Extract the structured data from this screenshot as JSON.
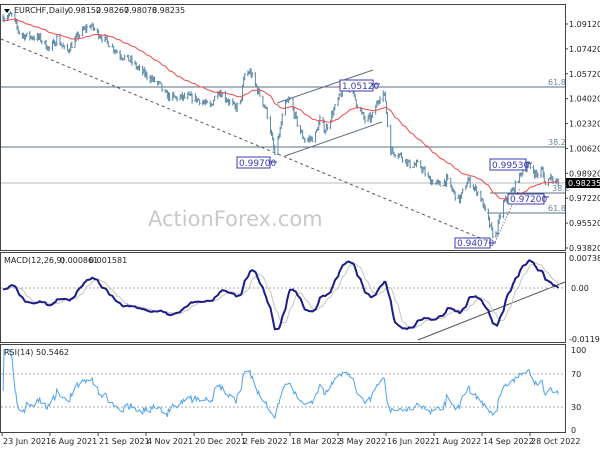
{
  "header": {
    "symbol": "EURCHF,Daily",
    "ohlc": [
      "0.98152",
      "0.98267",
      "0.98078",
      "0.98235"
    ]
  },
  "watermark": "ActionForex.com",
  "colors": {
    "bars": "#5f8aa6",
    "moving_average": "#f04848",
    "macd": "#1c1c8a",
    "signal": "#c4c4c4",
    "rsi": "#4ea2f0",
    "label_box": "#3b3bb0",
    "current_price_bg": "#000000"
  },
  "macd_panel": {
    "title": "MACD(12,26,9)",
    "value1": "0.000861",
    "value2": "0.001581",
    "axis_labels": [
      "0.007384",
      "0.00",
      "-0.0119"
    ]
  },
  "rsi_panel": {
    "title": "RSI(14)",
    "value": "50.5462",
    "axis_labels": [
      "100",
      "70",
      "30",
      "0"
    ]
  },
  "price_axis": {
    "ticks": [
      "1.09120",
      "1.07420",
      "1.05720",
      "1.04020",
      "1.02320",
      "1.00620",
      "0.98920",
      "0.97220",
      "0.95520",
      "0.93820"
    ],
    "current_price": "0.98235"
  },
  "annotations": {
    "price_labels": [
      "0.99700",
      "1.05120",
      "0.99530",
      "0.97200",
      "0.94070"
    ],
    "fib_levels": [
      {
        "label": "61.8",
        "price": 1.0482
      },
      {
        "label": "38.2",
        "price": 1.0072
      },
      {
        "label": "38.2",
        "price": 0.9799
      },
      {
        "label": "61.8",
        "price": 0.9621
      }
    ]
  },
  "chart_data": {
    "type": "line",
    "title": "EURCHF,Daily",
    "x_ticks": [
      "23 Jun 2021",
      "6 Aug 2021",
      "21 Sep 2021",
      "4 Nov 2021",
      "20 Dec 2021",
      "2 Feb 2022",
      "18 Mar 2022",
      "3 May 2022",
      "16 Jun 2022",
      "1 Aug 2022",
      "14 Sep 2022",
      "28 Oct 2022"
    ],
    "ylim": [
      0.9382,
      1.1004
    ],
    "grid": false,
    "close_waypoints": [
      [
        "2021-06-24",
        1.096
      ],
      [
        "2021-07-02",
        1.0973
      ],
      [
        "2021-07-10",
        1.0837
      ],
      [
        "2021-07-28",
        1.0816
      ],
      [
        "2021-08-07",
        1.0734
      ],
      [
        "2021-08-13",
        1.0816
      ],
      [
        "2021-08-22",
        1.0721
      ],
      [
        "2021-09-04",
        1.0851
      ],
      [
        "2021-09-13",
        1.0905
      ],
      [
        "2021-09-22",
        1.0837
      ],
      [
        "2021-10-02",
        1.0769
      ],
      [
        "2021-10-11",
        1.07
      ],
      [
        "2021-10-20",
        1.0666
      ],
      [
        "2021-10-29",
        1.0598
      ],
      [
        "2021-11-08",
        1.0543
      ],
      [
        "2021-11-17",
        1.0495
      ],
      [
        "2021-11-22",
        1.0427
      ],
      [
        "2021-12-01",
        1.0407
      ],
      [
        "2021-12-15",
        1.0413
      ],
      [
        "2021-12-24",
        1.0393
      ],
      [
        "2022-01-03",
        1.0345
      ],
      [
        "2022-01-10",
        1.0461
      ],
      [
        "2022-01-21",
        1.0379
      ],
      [
        "2022-01-26",
        1.0338
      ],
      [
        "2022-01-31",
        1.0372
      ],
      [
        "2022-02-04",
        1.0564
      ],
      [
        "2022-02-09",
        1.0584
      ],
      [
        "2022-02-16",
        1.0461
      ],
      [
        "2022-02-24",
        1.0325
      ],
      [
        "2022-02-28",
        1.0188
      ],
      [
        "2022-03-04",
        1.0017
      ],
      [
        "2022-03-09",
        1.0188
      ],
      [
        "2022-03-13",
        1.0359
      ],
      [
        "2022-03-18",
        1.0393
      ],
      [
        "2022-03-27",
        1.0188
      ],
      [
        "2022-04-01",
        1.012
      ],
      [
        "2022-04-10",
        1.0133
      ],
      [
        "2022-04-15",
        1.0256
      ],
      [
        "2022-04-20",
        1.0188
      ],
      [
        "2022-05-02",
        1.0393
      ],
      [
        "2022-05-08",
        1.0475
      ],
      [
        "2022-05-13",
        1.0482
      ],
      [
        "2022-05-22",
        1.0325
      ],
      [
        "2022-05-27",
        1.0256
      ],
      [
        "2022-06-02",
        1.027
      ],
      [
        "2022-06-12",
        1.0461
      ],
      [
        "2022-06-15",
        1.0393
      ],
      [
        "2022-06-19",
        1.0051
      ],
      [
        "2022-06-29",
        1.0017
      ],
      [
        "2022-07-08",
        0.9949
      ],
      [
        "2022-07-17",
        0.9949
      ],
      [
        "2022-07-26",
        0.9847
      ],
      [
        "2022-08-05",
        0.9812
      ],
      [
        "2022-08-11",
        0.9847
      ],
      [
        "2022-08-19",
        0.9744
      ],
      [
        "2022-08-23",
        0.971
      ],
      [
        "2022-08-31",
        0.9847
      ],
      [
        "2022-09-11",
        0.9744
      ],
      [
        "2022-09-20",
        0.9539
      ],
      [
        "2022-09-25",
        0.9437
      ],
      [
        "2022-10-02",
        0.9676
      ],
      [
        "2022-10-12",
        0.9778
      ],
      [
        "2022-10-21",
        0.9915
      ],
      [
        "2022-10-26",
        0.9949
      ],
      [
        "2022-11-03",
        0.9881
      ],
      [
        "2022-11-08",
        0.9915
      ],
      [
        "2022-11-12",
        0.9778
      ],
      [
        "2022-11-15",
        0.9881
      ],
      [
        "2022-11-23",
        0.98235
      ]
    ],
    "macd_ylim": [
      -0.0119,
      0.007384
    ],
    "rsi_ylim": [
      0,
      100
    ],
    "rsi_levels": [
      70,
      30
    ]
  }
}
